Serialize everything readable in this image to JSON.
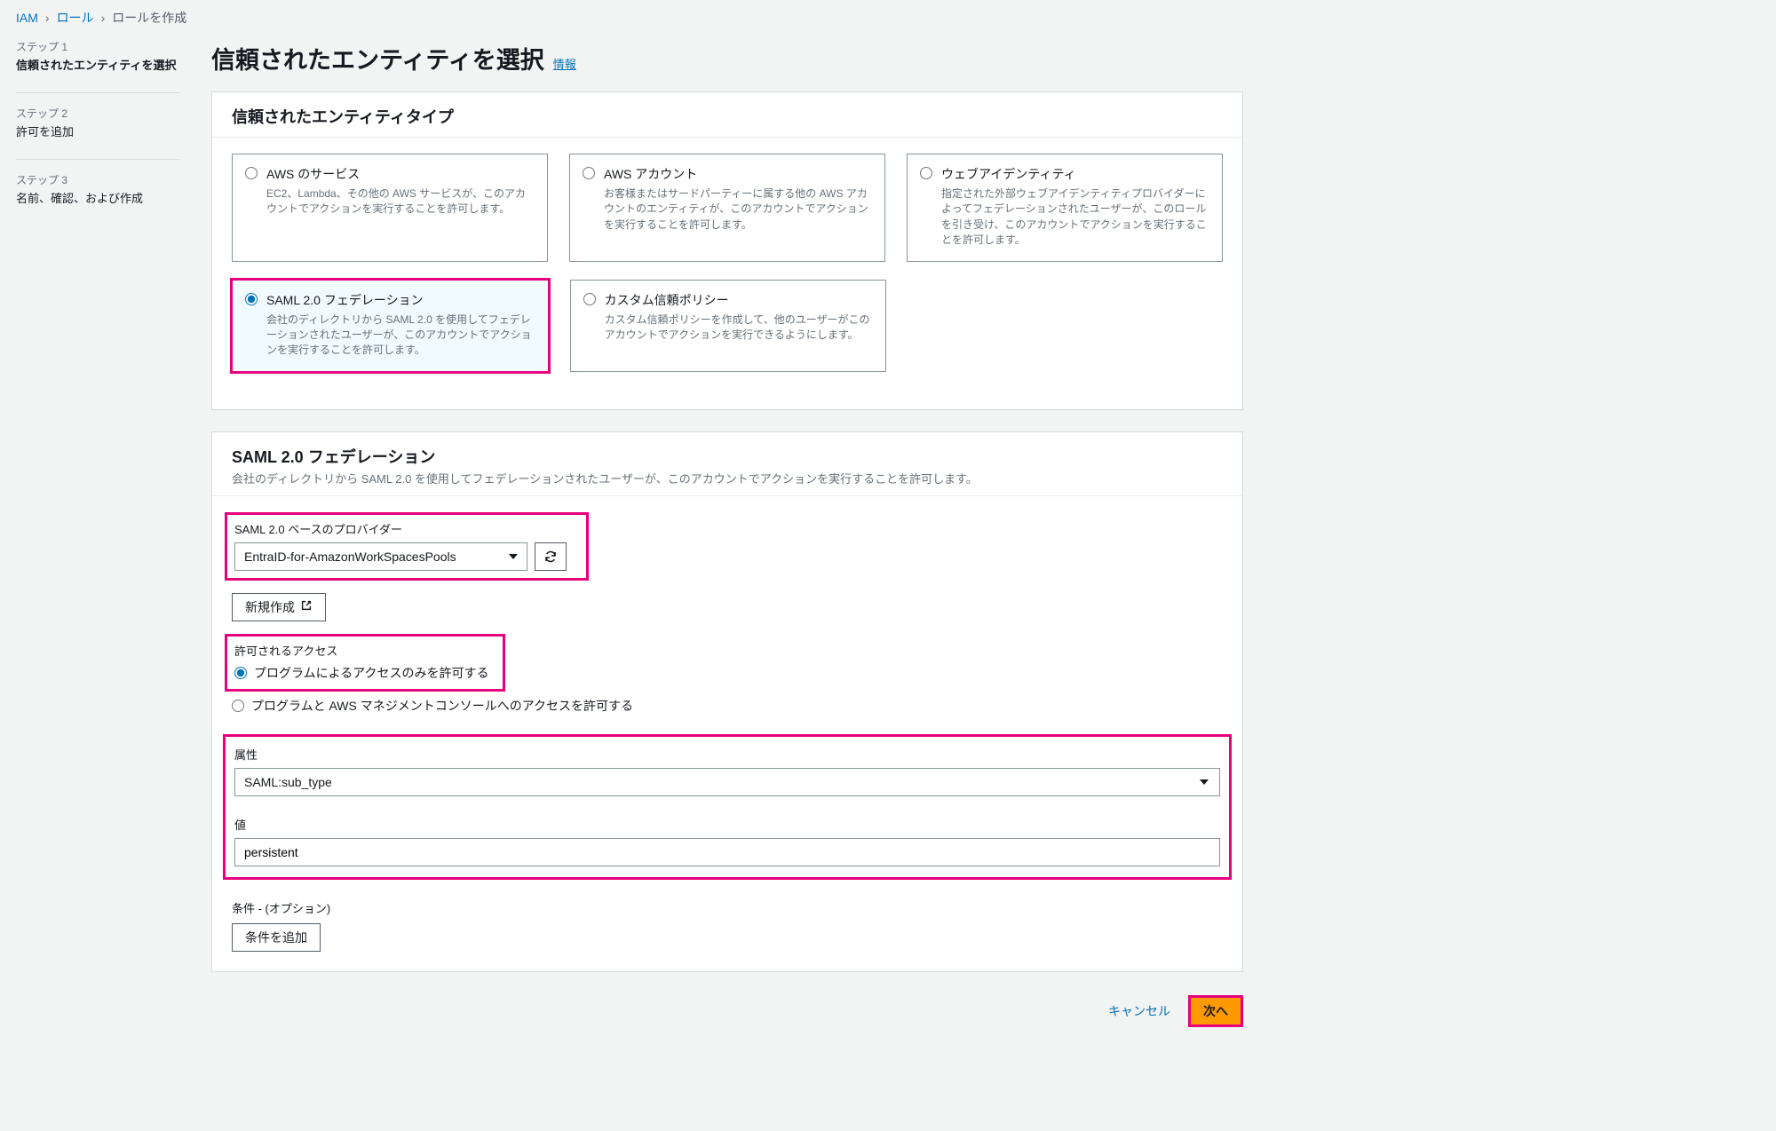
{
  "breadcrumbs": {
    "iam": "IAM",
    "roles": "ロール",
    "current": "ロールを作成"
  },
  "sidebar": {
    "steps": [
      {
        "label": "ステップ 1",
        "title": "信頼されたエンティティを選択"
      },
      {
        "label": "ステップ 2",
        "title": "許可を追加"
      },
      {
        "label": "ステップ 3",
        "title": "名前、確認、および作成"
      }
    ]
  },
  "page": {
    "title": "信頼されたエンティティを選択",
    "info_label": "情報"
  },
  "entity_types": {
    "heading": "信頼されたエンティティタイプ",
    "tiles": [
      {
        "title": "AWS のサービス",
        "desc": "EC2、Lambda、その他の AWS サービスが、このアカウントでアクションを実行することを許可します。"
      },
      {
        "title": "AWS アカウント",
        "desc": "お客様またはサードパーティーに属する他の AWS アカウントのエンティティが、このアカウントでアクションを実行することを許可します。"
      },
      {
        "title": "ウェブアイデンティティ",
        "desc": "指定された外部ウェブアイデンティティプロバイダーによってフェデレーションされたユーザーが、このロールを引き受け、このアカウントでアクションを実行することを許可します。"
      },
      {
        "title": "SAML 2.0 フェデレーション",
        "desc": "会社のディレクトリから SAML 2.0 を使用してフェデレーションされたユーザーが、このアカウントでアクションを実行することを許可します。"
      },
      {
        "title": "カスタム信頼ポリシー",
        "desc": "カスタム信頼ポリシーを作成して、他のユーザーがこのアカウントでアクションを実行できるようにします。"
      }
    ]
  },
  "saml": {
    "heading": "SAML 2.0 フェデレーション",
    "subtitle": "会社のディレクトリから SAML 2.0 を使用してフェデレーションされたユーザーが、このアカウントでアクションを実行することを許可します。",
    "provider_label": "SAML 2.0 ベースのプロバイダー",
    "provider_value": "EntraID-for-AmazonWorkSpacesPools",
    "create_new_label": "新規作成",
    "access_label": "許可されるアクセス",
    "access_option_prog": "プログラムによるアクセスのみを許可する",
    "access_option_prog_console": "プログラムと AWS マネジメントコンソールへのアクセスを許可する",
    "attribute_label": "属性",
    "attribute_value": "SAML:sub_type",
    "value_label": "値",
    "value_value": "persistent",
    "conditions_label": "条件 - (オプション)",
    "add_condition_label": "条件を追加"
  },
  "footer": {
    "cancel": "キャンセル",
    "next": "次へ"
  }
}
